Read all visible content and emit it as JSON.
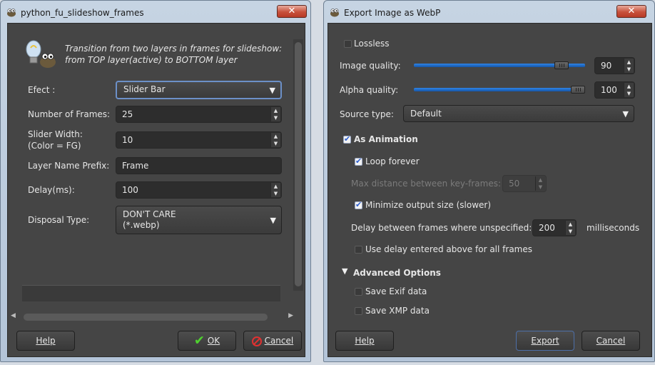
{
  "left_window": {
    "title": "python_fu_slideshow_frames",
    "description_line1": "Transition from two layers in frames for slideshow:",
    "description_line2": "from TOP layer(active) to BOTTOM layer",
    "fields": {
      "effect_label": "Efect :",
      "effect_value": "Slider Bar",
      "frames_label": "Number of Frames:",
      "frames_value": "25",
      "slider_width_label_1": "Slider Width:",
      "slider_width_label_2": "(Color = FG)",
      "slider_width_value": "10",
      "prefix_label": "Layer Name Prefix:",
      "prefix_value": "Frame",
      "delay_label": "Delay(ms):",
      "delay_value": "100",
      "disposal_label": "Disposal Type:",
      "disposal_value_1": "DON'T CARE",
      "disposal_value_2": "(*.webp)"
    },
    "buttons": {
      "help": "Help",
      "ok": "OK",
      "cancel": "Cancel"
    }
  },
  "right_window": {
    "title": "Export Image as WebP",
    "lossless_label": "Lossless",
    "lossless_checked": false,
    "image_quality_label": "Image quality:",
    "image_quality_value": "90",
    "image_quality_fraction": 0.9,
    "alpha_quality_label": "Alpha quality:",
    "alpha_quality_value": "100",
    "alpha_quality_fraction": 1.0,
    "source_type_label": "Source type:",
    "source_type_value": "Default",
    "as_animation_label": "As Animation",
    "as_animation_checked": true,
    "loop_forever_label": "Loop forever",
    "loop_forever_checked": true,
    "max_keyframes_label": "Max distance between key-frames:",
    "max_keyframes_value": "50",
    "minimize_label": "Minimize output size (slower)",
    "minimize_checked": true,
    "delay_label": "Delay between frames where unspecified:",
    "delay_value": "200",
    "delay_unit": "milliseconds",
    "use_delay_label": "Use delay entered above for all frames",
    "use_delay_checked": false,
    "advanced_label": "Advanced Options",
    "save_exif_label": "Save Exif data",
    "save_xmp_label": "Save XMP data",
    "buttons": {
      "help": "Help",
      "export": "Export",
      "cancel": "Cancel"
    }
  },
  "colors": {
    "panel_bg": "#454545",
    "field_bg": "#2d2d2d",
    "slider_blue": "#1f6fd0",
    "check_blue": "#2d5fd1"
  }
}
